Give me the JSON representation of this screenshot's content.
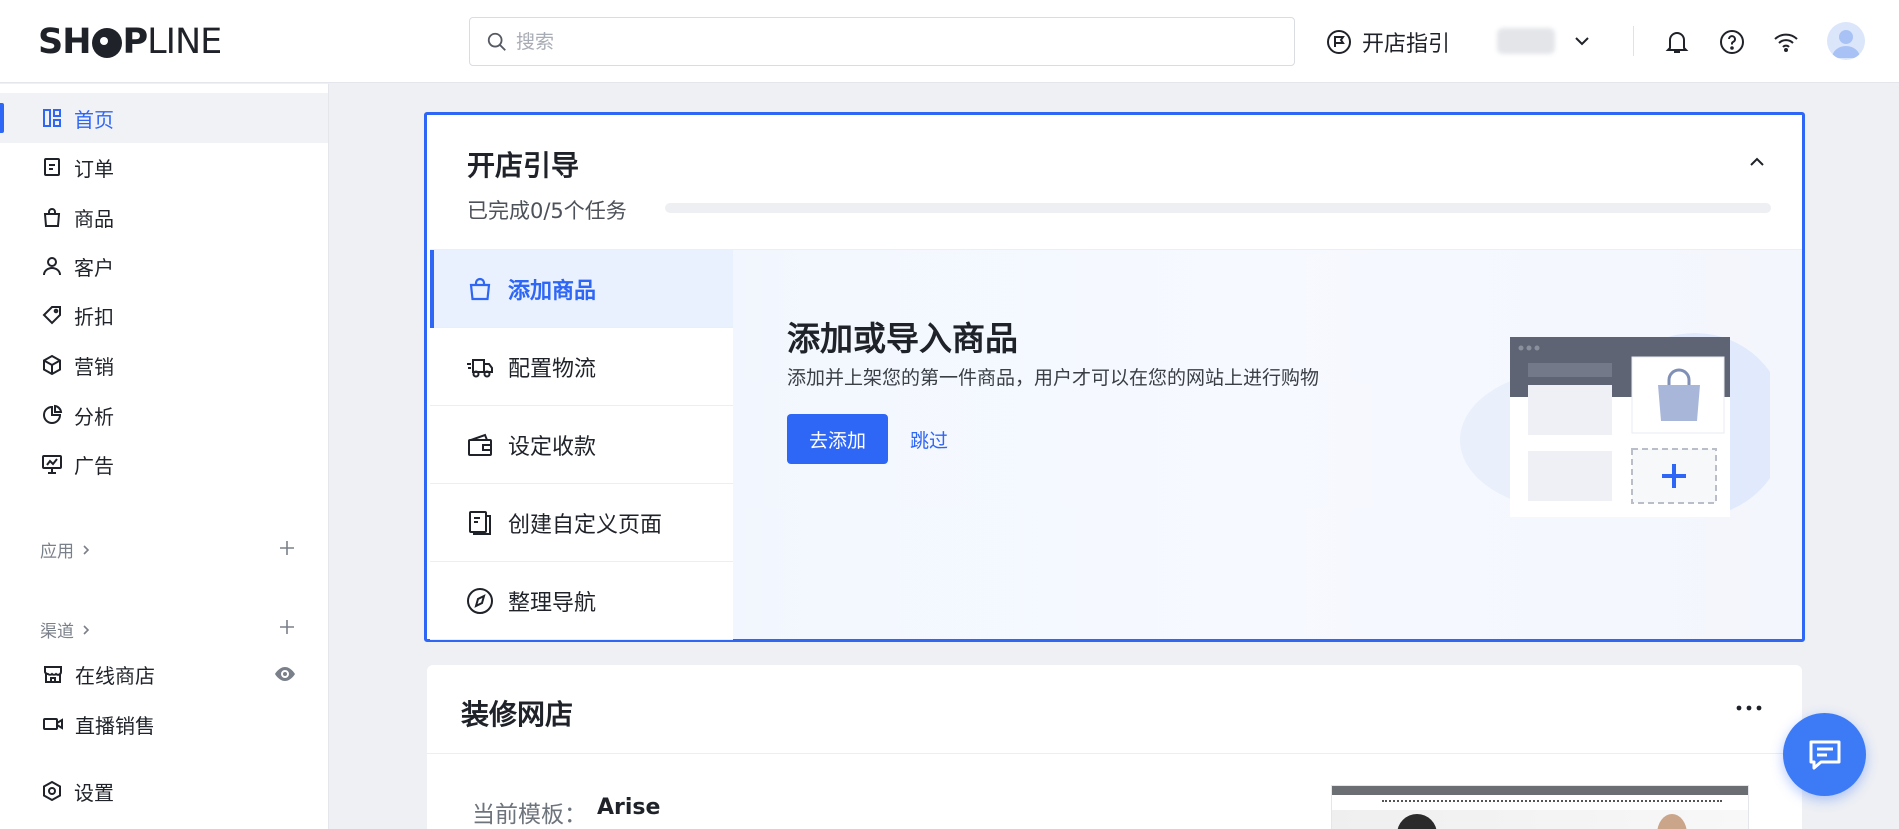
{
  "brand": {
    "logo_prefix": "SH",
    "logo_mid": "P",
    "logo_suffix": "LINE",
    "accent": "#2e66f6"
  },
  "header": {
    "search_placeholder": "搜索",
    "guide_label": "开店指引",
    "icons": [
      "bell-icon",
      "help-icon",
      "wifi-icon",
      "avatar"
    ]
  },
  "sidebar": {
    "items": [
      {
        "label": "首页",
        "icon": "dashboard-icon",
        "active": true
      },
      {
        "label": "订单",
        "icon": "order-icon"
      },
      {
        "label": "商品",
        "icon": "bag-icon"
      },
      {
        "label": "客户",
        "icon": "user-icon"
      },
      {
        "label": "折扣",
        "icon": "tag-icon"
      },
      {
        "label": "营销",
        "icon": "cube-icon"
      },
      {
        "label": "分析",
        "icon": "pie-icon"
      },
      {
        "label": "广告",
        "icon": "ad-icon"
      }
    ],
    "apps_label": "应用",
    "channels_label": "渠道",
    "channels": [
      {
        "label": "在线商店",
        "icon": "store-icon"
      },
      {
        "label": "直播销售",
        "icon": "video-icon"
      }
    ],
    "settings_label": "设置"
  },
  "guide": {
    "title": "开店引导",
    "progress_text": "已完成0/5个任务",
    "progress_fraction": 0,
    "tasks": [
      {
        "label": "添加商品",
        "active": true
      },
      {
        "label": "配置物流"
      },
      {
        "label": "设定收款"
      },
      {
        "label": "创建自定义页面"
      },
      {
        "label": "整理导航"
      }
    ],
    "detail": {
      "title": "添加或导入商品",
      "description": "添加并上架您的第一件商品，用户才可以在您的网站上进行购物",
      "primary_button": "去添加",
      "skip_link": "跳过"
    }
  },
  "decorate": {
    "title": "装修网店",
    "template_label": "当前模板：",
    "template_name": "Arise"
  }
}
